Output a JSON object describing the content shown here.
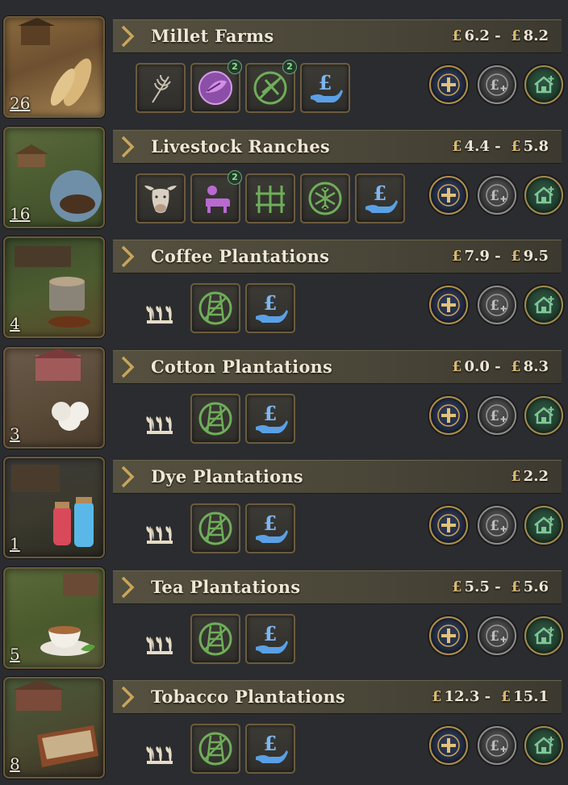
{
  "buildings": [
    {
      "name": "Millet Farms",
      "count": "26",
      "price_low": "6.2",
      "price_high": "8.2",
      "thumb": "millet-thumb",
      "modes": [
        {
          "icon": "wheat-icon",
          "badge": ""
        },
        {
          "icon": "fertilizer-icon",
          "badge": "2"
        },
        {
          "icon": "no-tools-icon",
          "badge": "2"
        },
        {
          "icon": "subsidy-icon",
          "badge": ""
        }
      ]
    },
    {
      "name": "Livestock Ranches",
      "count": "16",
      "price_low": "4.4",
      "price_high": "5.8",
      "thumb": "ranch-thumb",
      "modes": [
        {
          "icon": "cow-icon",
          "badge": ""
        },
        {
          "icon": "herder-icon",
          "badge": "2"
        },
        {
          "icon": "fence-icon",
          "badge": ""
        },
        {
          "icon": "refrigeration-icon",
          "badge": ""
        },
        {
          "icon": "subsidy-icon",
          "badge": ""
        }
      ]
    },
    {
      "name": "Coffee Plantations",
      "count": "4",
      "price_low": "7.9",
      "price_high": "9.5",
      "thumb": "coffee-thumb",
      "modes": [
        {
          "icon": "crops-icon",
          "badge": ""
        },
        {
          "icon": "no-railway-icon",
          "badge": ""
        },
        {
          "icon": "subsidy-icon",
          "badge": ""
        }
      ]
    },
    {
      "name": "Cotton Plantations",
      "count": "3",
      "price_low": "0.0",
      "price_high": "8.3",
      "thumb": "cotton-thumb",
      "modes": [
        {
          "icon": "crops-icon",
          "badge": ""
        },
        {
          "icon": "no-railway-icon",
          "badge": ""
        },
        {
          "icon": "subsidy-icon",
          "badge": ""
        }
      ]
    },
    {
      "name": "Dye Plantations",
      "count": "1",
      "price_low": "",
      "price_high": "2.2",
      "thumb": "dye-thumb",
      "modes": [
        {
          "icon": "crops-icon",
          "badge": ""
        },
        {
          "icon": "no-railway-icon",
          "badge": ""
        },
        {
          "icon": "subsidy-icon",
          "badge": ""
        }
      ]
    },
    {
      "name": "Tea Plantations",
      "count": "5",
      "price_low": "5.5",
      "price_high": "5.6",
      "thumb": "tea-thumb",
      "modes": [
        {
          "icon": "crops-icon",
          "badge": ""
        },
        {
          "icon": "no-railway-icon",
          "badge": ""
        },
        {
          "icon": "subsidy-icon",
          "badge": ""
        }
      ]
    },
    {
      "name": "Tobacco Plantations",
      "count": "8",
      "price_low": "12.3",
      "price_high": "15.1",
      "thumb": "tobacco-thumb",
      "modes": [
        {
          "icon": "crops-icon",
          "badge": ""
        },
        {
          "icon": "no-railway-icon",
          "badge": ""
        },
        {
          "icon": "subsidy-icon",
          "badge": ""
        }
      ]
    }
  ],
  "currency_symbol": "£",
  "price_separator": "-",
  "buttons": {
    "expand": "plus-icon",
    "subsidize": "pound-plus-icon",
    "build": "house-plus-icon"
  },
  "colors": {
    "gold": "#d8b875",
    "mode_green": "#6fae5a",
    "mode_blue": "#5aa0e6",
    "mode_purple": "#b86ad0"
  }
}
